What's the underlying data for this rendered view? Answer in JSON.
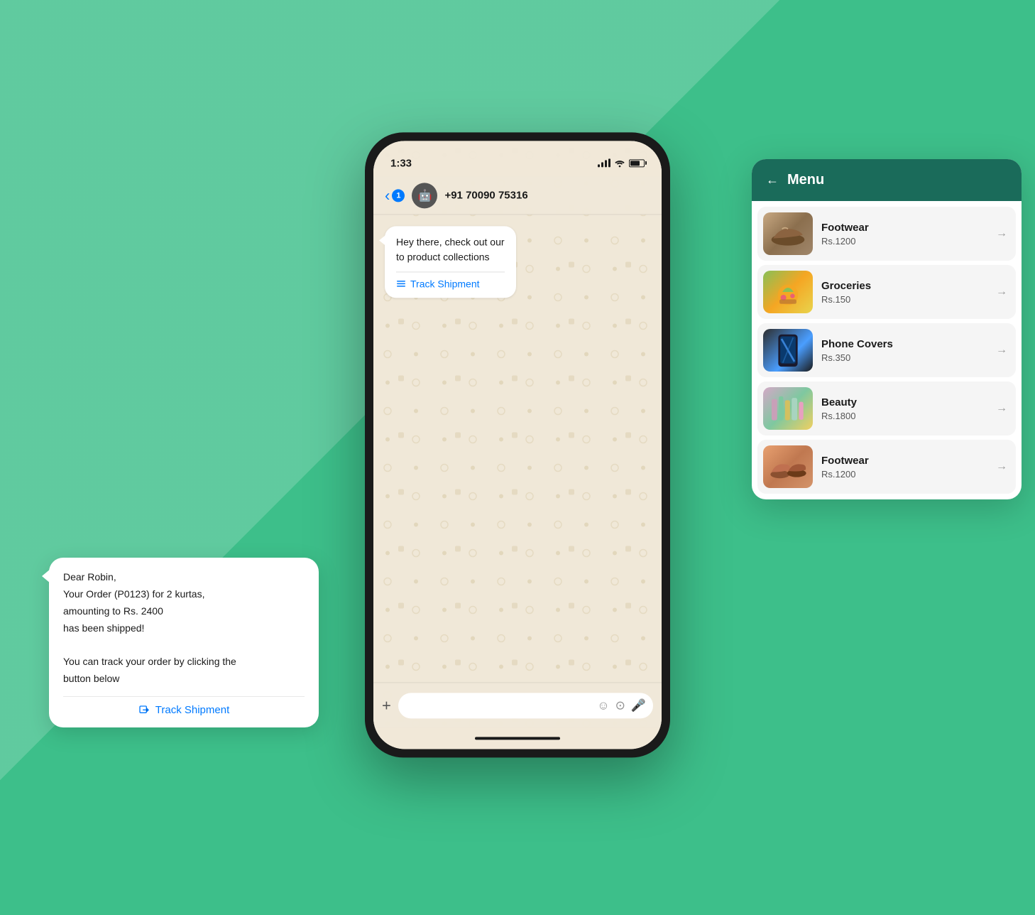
{
  "background": {
    "color": "#3dbf8a"
  },
  "status_bar": {
    "time": "1:33",
    "signal": "signal",
    "wifi": "wifi",
    "battery": "battery"
  },
  "chat_header": {
    "back_label": "‹",
    "badge": "1",
    "contact_name": "+91 70090 75316",
    "avatar_emoji": "🤖"
  },
  "messages": [
    {
      "text": "Hey there, check out our\nto product collections",
      "track_link": "Track Shipment"
    },
    {
      "text": "Dear Robin,\nYour Order (P0123) for 2 kurtas,\namounting to Rs. 2400\nhas been shipped!\n\nYou can track your order by clicking the\nbutton below",
      "track_link": "Track Shipment"
    }
  ],
  "chat_input": {
    "plus_icon": "+",
    "sticker_icon": "🙂",
    "camera_icon": "📷",
    "mic_icon": "🎤"
  },
  "menu": {
    "header_title": "Menu",
    "back_icon": "←",
    "items": [
      {
        "name": "Footwear",
        "price": "Rs.1200",
        "emoji": "👟"
      },
      {
        "name": "Groceries",
        "price": "Rs.150",
        "emoji": "🌿"
      },
      {
        "name": "Phone Covers",
        "price": "Rs.350",
        "emoji": "📱"
      },
      {
        "name": "Beauty",
        "price": "Rs.1800",
        "emoji": "💄"
      },
      {
        "name": "Footwear",
        "price": "Rs.1200",
        "emoji": "👠"
      }
    ]
  }
}
